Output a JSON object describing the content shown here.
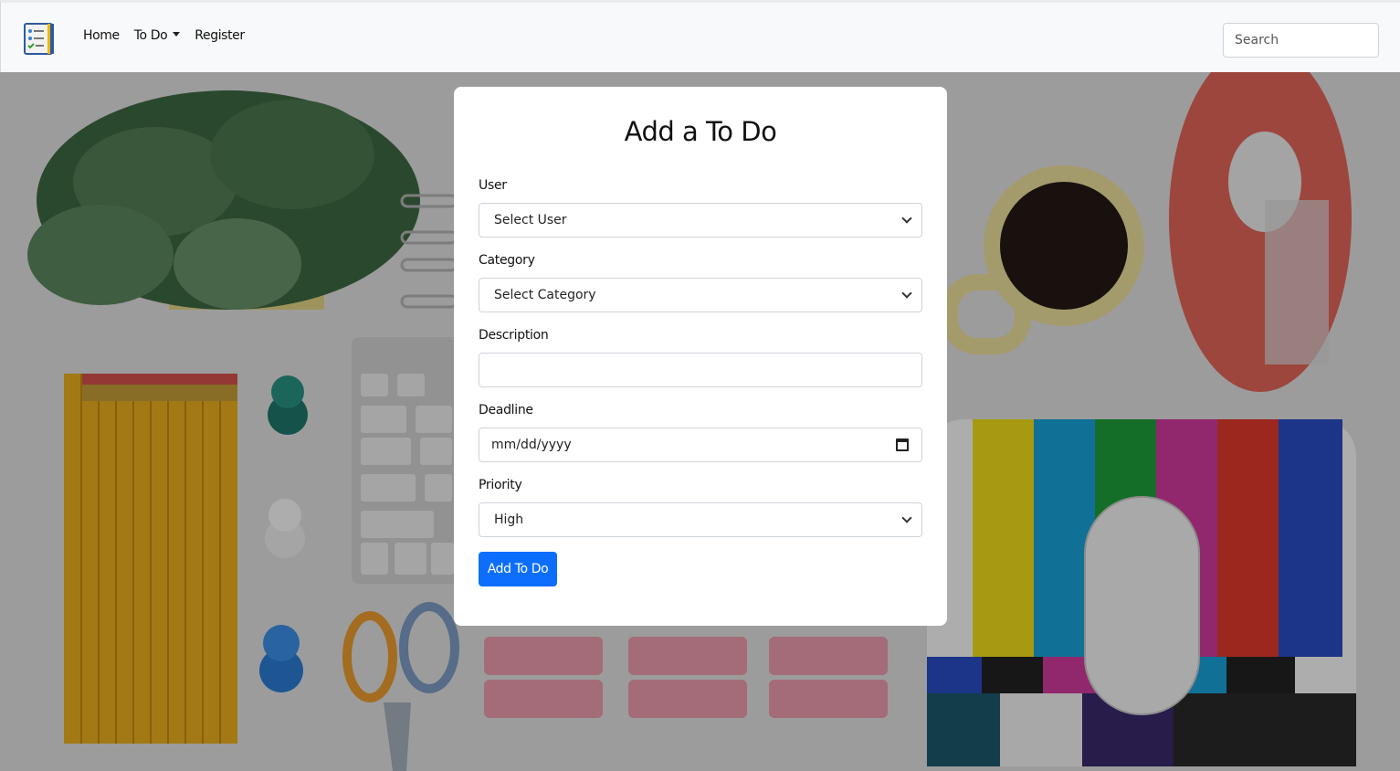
{
  "navbar": {
    "links": {
      "home": "Home",
      "todo": "To Do",
      "register": "Register"
    },
    "search_placeholder": "Search"
  },
  "form": {
    "title": "Add a To Do",
    "user": {
      "label": "User",
      "value": "Select User"
    },
    "category": {
      "label": "Category",
      "value": "Select Category"
    },
    "description": {
      "label": "Description",
      "value": ""
    },
    "deadline": {
      "label": "Deadline",
      "value": "mm/dd/yyyy"
    },
    "priority": {
      "label": "Priority",
      "value": "High"
    },
    "submit_label": "Add To Do"
  },
  "colors": {
    "accent": "#0d6efd",
    "navbar_bg": "#f8f9fa"
  }
}
